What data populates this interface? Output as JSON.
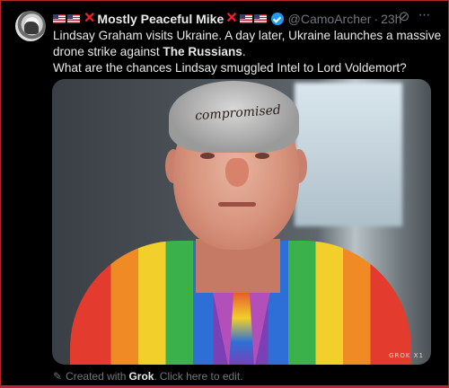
{
  "post": {
    "author_name": "Mostly Peaceful Mike",
    "handle": "@CamoArcher",
    "separator": "·",
    "time": "23h",
    "text_lines": {
      "l1": "Lindsay Graham visits Ukraine. A day later, Ukraine launches a massive",
      "l2_pre": "drone strike against ",
      "l2_bold": "The Russians",
      "l2_post": ".",
      "l3": "What are the chances Lindsay smuggled Intel to Lord Voldemort?"
    },
    "image": {
      "forehead_text": "compromised",
      "watermark": "GROK X1"
    },
    "footer": {
      "created_prefix": "Created with",
      "created_brand": "Grok",
      "created_suffix": ".",
      "edit_link": "Click here to edit."
    }
  },
  "icons": {
    "verified": "verified-badge-icon",
    "grok": "grok-icon",
    "more": "more-icon",
    "pencil": "pencil-icon"
  },
  "colors": {
    "background": "#000000",
    "text": "#e7e9ea",
    "muted": "#71767b",
    "verified": "#1d9bf0",
    "frame": "#b3262b",
    "cross": "#f4212e"
  }
}
